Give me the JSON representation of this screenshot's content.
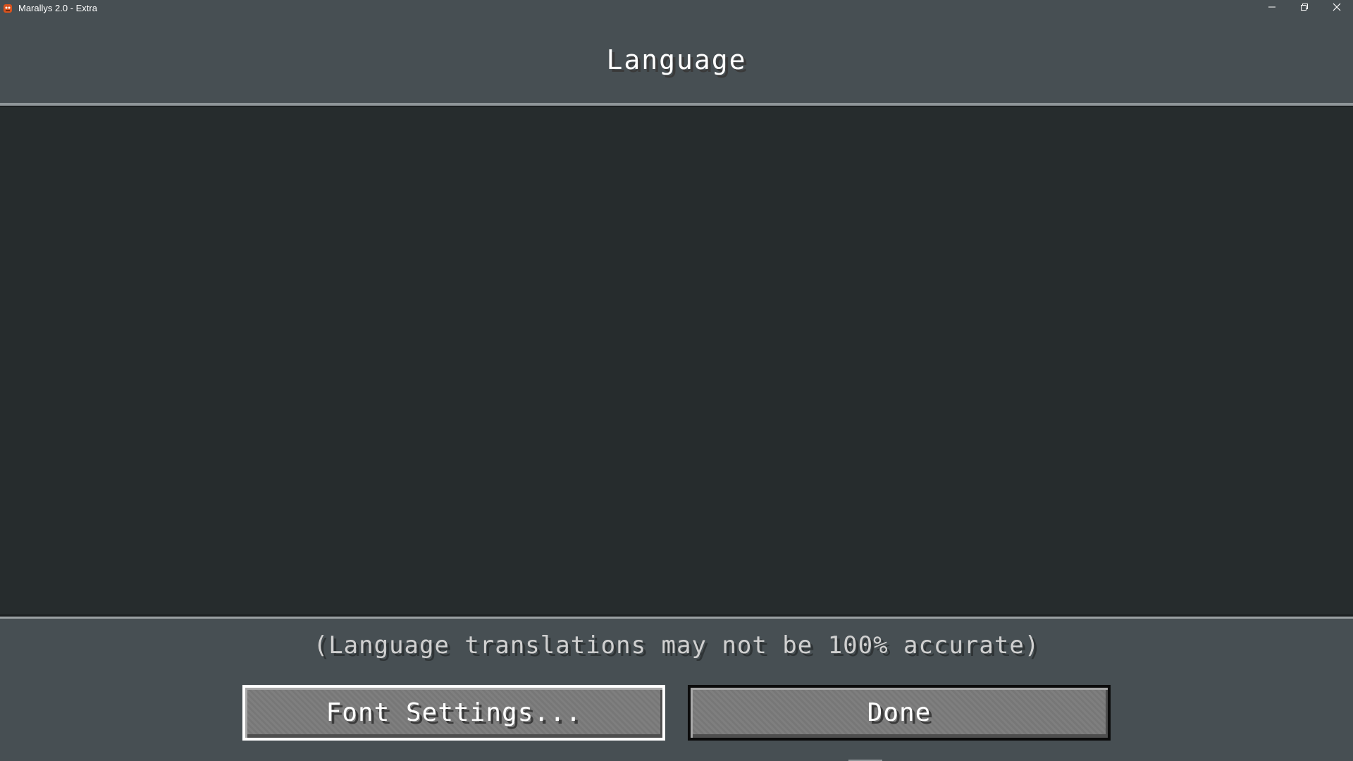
{
  "window": {
    "title": "Marallys 2.0 - Extra",
    "controls": {
      "minimize_icon": "minimize-icon",
      "restore_icon": "restore-icon",
      "close_icon": "close-icon"
    }
  },
  "screen": {
    "title": "Language",
    "notice": "(Language translations may not be 100% accurate)"
  },
  "buttons": {
    "font_settings": "Font Settings...",
    "done": "Done"
  },
  "colors": {
    "background": "#474f53",
    "list_background": "#262c2d",
    "button_face": "#7b7b7b",
    "focused_border": "#ffffff",
    "text": "#ffffff"
  }
}
